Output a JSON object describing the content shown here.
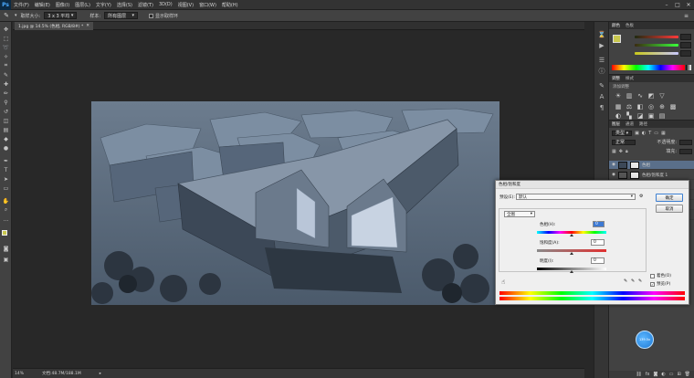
{
  "menubar": {
    "logo": "Ps",
    "items": [
      "文件(F)",
      "编辑(E)",
      "图像(I)",
      "图层(L)",
      "文字(Y)",
      "选择(S)",
      "滤镜(T)",
      "3D(D)",
      "视图(V)",
      "窗口(W)",
      "帮助(H)"
    ],
    "controls": [
      "–",
      "□",
      "✕"
    ]
  },
  "options": {
    "sample_size_label": "取样大小:",
    "sample_size_value": "3 x 3 平均",
    "sample_label": "样本:",
    "sample_value": "所有图层",
    "show_ring_label": "显示取样环"
  },
  "document": {
    "tab_label": "1.jpg @ 14.5% (色相, RGB/8#) *",
    "zoom": "14%",
    "doc_size": "文档:48.7M/188.1M"
  },
  "color_panel": {
    "tabs": [
      "颜色",
      "色板"
    ],
    "values": [
      "",
      "",
      ""
    ]
  },
  "adjustments_panel": {
    "tabs": [
      "调整",
      "样式"
    ],
    "subtitle": "添加调整"
  },
  "layers_panel": {
    "tabs": [
      "图层",
      "通道",
      "路径"
    ],
    "kind": "类型",
    "blend_mode": "正常",
    "opacity_label": "不透明度:",
    "fill_label": "填充:",
    "layers": [
      {
        "name": "色相"
      },
      {
        "name": "色相/饱和度 1"
      },
      {
        "name": ""
      },
      {
        "name": ""
      },
      {
        "name": ""
      },
      {
        "name": ""
      }
    ]
  },
  "dialog": {
    "title": "色相/饱和度",
    "preset_label": "预设(E):",
    "preset_value": "默认",
    "ok": "确定",
    "cancel": "取消",
    "channel_value": "全图",
    "hue_label": "色相(H):",
    "hue_value": "0",
    "saturation_label": "饱和度(A):",
    "saturation_value": "0",
    "lightness_label": "明度(I):",
    "lightness_value": "0",
    "colorize_label": "着色(O)",
    "preview_label": "预览(P)",
    "hue_level": 0.5,
    "saturation_level": 0.5,
    "lightness_level": 0.5
  },
  "cursor_badge": "139.5x",
  "colors": {
    "accent": "#1e7ad6",
    "foreground": "#c9c84e",
    "background": "#1a1a1a"
  }
}
